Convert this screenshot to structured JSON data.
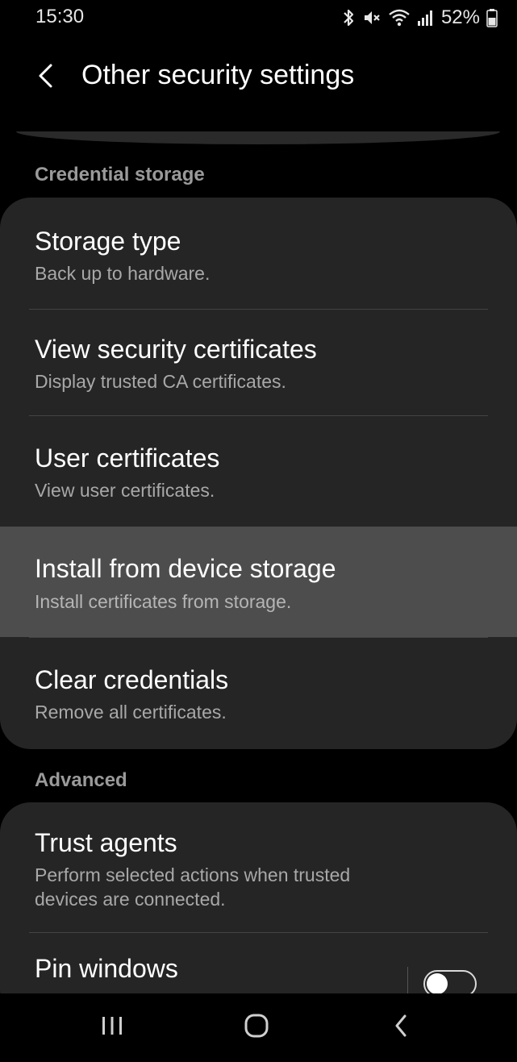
{
  "status": {
    "time": "15:30",
    "battery": "52%"
  },
  "header": {
    "title": "Other security settings"
  },
  "sections": {
    "credential_storage": {
      "label": "Credential storage",
      "items": [
        {
          "title": "Storage type",
          "subtitle": "Back up to hardware."
        },
        {
          "title": "View security certificates",
          "subtitle": "Display trusted CA certificates."
        },
        {
          "title": "User certificates",
          "subtitle": "View user certificates."
        },
        {
          "title": "Install from device storage",
          "subtitle": "Install certificates from storage."
        },
        {
          "title": "Clear credentials",
          "subtitle": "Remove all certificates."
        }
      ]
    },
    "advanced": {
      "label": "Advanced",
      "items": [
        {
          "title": "Trust agents",
          "subtitle_line1": "Perform selected actions when trusted",
          "subtitle_line2": "devices are connected."
        },
        {
          "title": "Pin windows",
          "toggle": "off"
        }
      ]
    }
  },
  "colors": {
    "background": "#000000",
    "card": "#252525",
    "highlight": "#4d4d4d",
    "section_header": "#9a9a9a"
  },
  "icons": [
    "back-arrow-icon",
    "bluetooth-icon",
    "mute-icon",
    "wifi-icon",
    "signal-icon",
    "battery-icon",
    "recents-icon",
    "home-icon",
    "nav-back-icon"
  ]
}
